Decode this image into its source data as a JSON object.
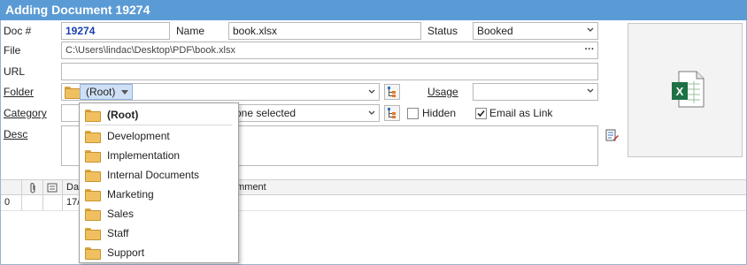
{
  "window": {
    "title": "Adding Document 19274"
  },
  "form": {
    "doc_label": "Doc #",
    "doc_value": "19274",
    "name_label": "Name",
    "name_value": "book.xlsx",
    "status_label": "Status",
    "status_value": "Booked",
    "file_label": "File",
    "file_value": "C:\\Users\\lindac\\Desktop\\PDF\\book.xlsx",
    "file_button": "···",
    "url_label": "URL",
    "url_value": "",
    "folder_label": "Folder",
    "folder_value": "(Root)",
    "usage_label": "Usage",
    "usage_value": "",
    "category_label": "Category",
    "category_value": "one selected",
    "hidden_label": "Hidden",
    "hidden_checked": false,
    "email_label": "Email as Link",
    "email_checked": true,
    "desc_label": "Desc",
    "desc_value": ""
  },
  "grid": {
    "headers": [
      "Da",
      "omment"
    ],
    "rows": [
      {
        "index": "0",
        "date": "17/"
      }
    ]
  },
  "folder_dropdown": {
    "items": [
      "(Root)",
      "Development",
      "Implementation",
      "Internal Documents",
      "Marketing",
      "Sales",
      "Staff",
      "Support"
    ]
  },
  "icons": {
    "preview": "excel-file-icon",
    "folder": "folder-icon",
    "tree": "tree-view-icon",
    "attach": "paperclip-icon",
    "note": "note-icon",
    "edit_desc": "edit-description-icon"
  },
  "colors": {
    "titlebar": "#5b9bd5",
    "docnum": "#1a3fb0",
    "excel_green": "#1e7145"
  }
}
